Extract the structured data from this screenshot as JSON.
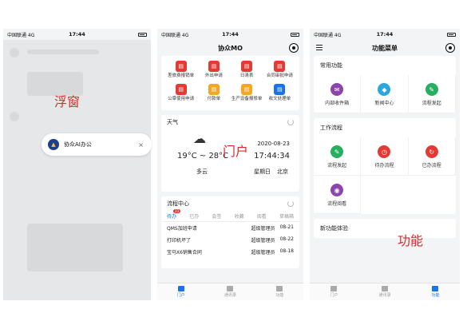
{
  "status": {
    "carrier": "中国联通 4G",
    "time": "17:44"
  },
  "floating": {
    "label": "浮窗",
    "title": "协众AI办公",
    "close": "×"
  },
  "portal": {
    "title": "协众MO",
    "label": "门户",
    "apps": [
      {
        "name": "差旅费报销单",
        "color": "#e53935"
      },
      {
        "name": "外出申请",
        "color": "#e53935"
      },
      {
        "name": "日清表",
        "color": "#e53935"
      },
      {
        "name": "合同审批申请",
        "color": "#e53935"
      },
      {
        "name": "公章使用申请",
        "color": "#e53935"
      },
      {
        "name": "付款单",
        "color": "#f5a623"
      },
      {
        "name": "生产设备报修单",
        "color": "#f5a623"
      },
      {
        "name": "收文处理单",
        "color": "#1a73e8"
      }
    ],
    "weather": {
      "title": "天气",
      "date": "2020-08-23",
      "temp": "19°C ~ 28°C",
      "time": "17:44:34",
      "cond": "多云",
      "weekday": "星期日",
      "city": "北京"
    },
    "flow": {
      "title": "流程中心",
      "tabs": [
        "待办",
        "已办",
        "会签",
        "收藏",
        "阅看",
        "草稿箱"
      ],
      "badge": "23",
      "rows": [
        {
          "name": "QMS加班申请",
          "who": "超级管理员",
          "date": "08-21"
        },
        {
          "name": "打印机坏了",
          "who": "超级管理员",
          "date": "08-22"
        },
        {
          "name": "宝马X6销售合同",
          "who": "超级管理员",
          "date": "08-18"
        }
      ]
    }
  },
  "menu": {
    "title": "功能菜单",
    "label": "功能",
    "sections": [
      {
        "title": "常用功能",
        "items": [
          {
            "name": "内部收件箱",
            "color": "#8e44ad",
            "glyph": "✉"
          },
          {
            "name": "新闻中心",
            "color": "#2aa6e0",
            "glyph": "◆"
          },
          {
            "name": "流程发起",
            "color": "#27ae60",
            "glyph": "✎"
          }
        ]
      },
      {
        "title": "工作流程",
        "items": [
          {
            "name": "流程发起",
            "color": "#27ae60",
            "glyph": "✎"
          },
          {
            "name": "待办流程",
            "color": "#e53935",
            "glyph": "◷"
          },
          {
            "name": "已办流程",
            "color": "#e53935",
            "glyph": "↻"
          },
          {
            "name": "流程阅看",
            "color": "#8e44ad",
            "glyph": "◉"
          }
        ]
      },
      {
        "title": "新功能体验",
        "items": []
      }
    ]
  },
  "tabbar": [
    "门户",
    "通讯录",
    "功能"
  ]
}
